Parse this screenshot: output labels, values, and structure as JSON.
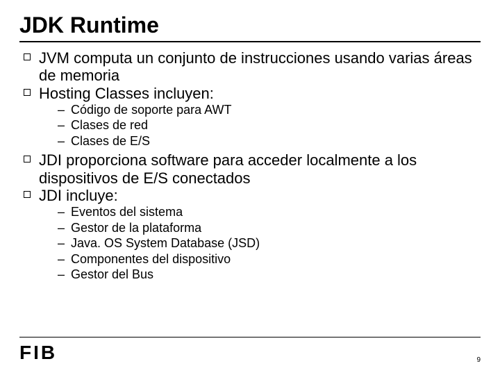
{
  "title": "JDK Runtime",
  "bullets": {
    "b0": "JVM computa un conjunto de instrucciones usando varias áreas de memoria",
    "b1": "Hosting Classes incluyen:",
    "b1_sub": {
      "s0": "Código de soporte para AWT",
      "s1": "Clases de red",
      "s2": "Clases de E/S"
    },
    "b2": "JDI proporciona software para acceder localmente a los dispositivos de E/S conectados",
    "b3": "JDI incluye:",
    "b3_sub": {
      "s0": "Eventos del sistema",
      "s1": "Gestor de la plataforma",
      "s2": "Java. OS System Database (JSD)",
      "s3": "Componentes del dispositivo",
      "s4": "Gestor del Bus"
    }
  },
  "footer": {
    "logo": {
      "f": "F",
      "i": "I",
      "b": "B"
    },
    "page": "9"
  }
}
